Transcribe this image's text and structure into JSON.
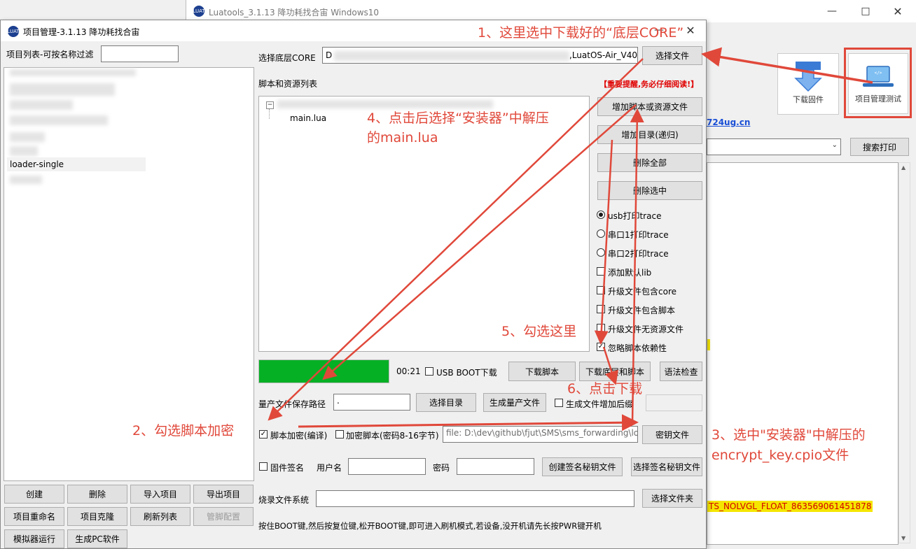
{
  "back_window": {
    "title": "Luatools_3.1.13 降功耗找合宙 Windows10",
    "download_firmware_label": "下载固件",
    "project_mgmt_label": "项目管理测试",
    "link_text": "724ug.cn",
    "search_print_label": "搜索打印",
    "log_highlight": "TS_NOLVGL_FLOAT_863569061451878"
  },
  "front_window": {
    "title": "项目管理-3.1.13 降功耗找合宙",
    "filter_label": "项目列表-可按名称过滤",
    "project_items": [
      "loader-single"
    ],
    "left_buttons": [
      "创建",
      "删除",
      "导入项目",
      "导出项目",
      "项目重命名",
      "项目克隆",
      "刷新列表",
      "管脚配置",
      "模拟器运行",
      "生成PC软件"
    ],
    "core_label": "选择底层CORE",
    "core_path_prefix": "D",
    "core_path_suffix": ",LuatOS-Air_V40",
    "select_file": "选择文件",
    "script_list_label": "脚本和资源列表",
    "warning": "【重要提醒,务必仔细阅读!】",
    "tree_child": "main.lua",
    "add_script": "增加脚本或资源文件",
    "add_dir": "增加目录(递归)",
    "delete_all": "删除全部",
    "delete_selected": "删除选中",
    "options": {
      "usb_trace": "usb打印trace",
      "uart1_trace": "串口1打印trace",
      "uart2_trace": "串口2打印trace",
      "add_default_lib": "添加默认lib",
      "upgrade_core": "升级文件包含core",
      "upgrade_script": "升级文件包含脚本",
      "upgrade_no_res": "升级文件无资源文件",
      "ignore_dep": "忽略脚本依赖性"
    },
    "progress": 1.0,
    "timer": "00:21",
    "usb_boot": "USB BOOT下载",
    "download_script": "下载脚本",
    "download_core_script": "下载底层和脚本",
    "syntax_check": "语法检查",
    "mass_path_label": "量产文件保存路径",
    "mass_path_value": ".",
    "select_dir": "选择目录",
    "gen_mass": "生成量产文件",
    "suffix_label": "生成文件增加后缀",
    "encrypt_label": "脚本加密(编译)",
    "encrypt_key_label": "加密脚本(密码8-16字节)",
    "key_path": "file: D:\\dev\\github\\fjut\\SMS\\sms_forwarding\\lo",
    "key_file": "密钥文件",
    "fw_sign": "固件签名",
    "username": "用户名",
    "password": "密码",
    "create_sign_key": "创建签名秘钥文件",
    "select_sign_key": "选择签名秘钥文件",
    "burn_fs_label": "烧录文件系统",
    "select_folder": "选择文件夹",
    "footer_tip": "按住BOOT键,然后按复位键,松开BOOT键,即可进入刷机模式,若设备,没开机请先长按PWR键开机"
  },
  "annotations": {
    "a1": "1、这里选中下载好的“底层CORE”",
    "a2": "2、勾选脚本加密",
    "a3_line1": "3、选中\"安装器\"中解压的",
    "a3_line2": "encrypt_key.cpio文件",
    "a4_line1": "4、点击后选择“安装器”中解压",
    "a4_line2": "的main.lua",
    "a5": "5、勾选这里",
    "a6": "6、点击下载"
  },
  "colors": {
    "annotation_red": "#e0483a",
    "progress_green": "#06b025",
    "warning_red": "#e00000"
  }
}
